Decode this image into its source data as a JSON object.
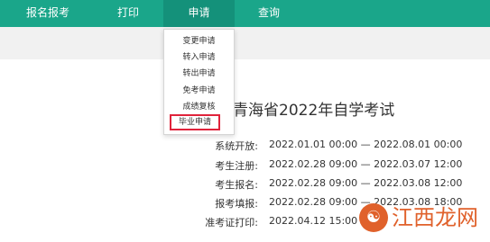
{
  "nav": {
    "items": [
      {
        "label": "报名报考"
      },
      {
        "label": "打印"
      },
      {
        "label": "申请"
      },
      {
        "label": "查询"
      }
    ]
  },
  "dropdown": {
    "items": [
      {
        "label": "变更申请"
      },
      {
        "label": "转入申请"
      },
      {
        "label": "转出申请"
      },
      {
        "label": "免考申请"
      },
      {
        "label": "成绩复核"
      },
      {
        "label": "毕业申请"
      }
    ]
  },
  "main": {
    "title": "青海省2022年自学考试",
    "schedule": [
      {
        "label": "系统开放:",
        "value": "2022.01.01 00:00 — 2022.08.01 00:00"
      },
      {
        "label": "考生注册:",
        "value": "2022.02.28 09:00 — 2022.03.07 12:00"
      },
      {
        "label": "考生报名:",
        "value": "2022.02.28 09:00 — 2022.03.08 12:00"
      },
      {
        "label": "报考填报:",
        "value": "2022.02.28 09:00 — 2022.03.08 18:00"
      },
      {
        "label": "准考证打印:",
        "value": "2022.04.12 15:00 —"
      }
    ]
  },
  "watermark": {
    "text": "江西龙网"
  },
  "colors": {
    "nav_bg": "#1aa68a",
    "nav_active": "#14917a",
    "highlight_border": "#e0233b",
    "watermark": "#e0612b"
  }
}
